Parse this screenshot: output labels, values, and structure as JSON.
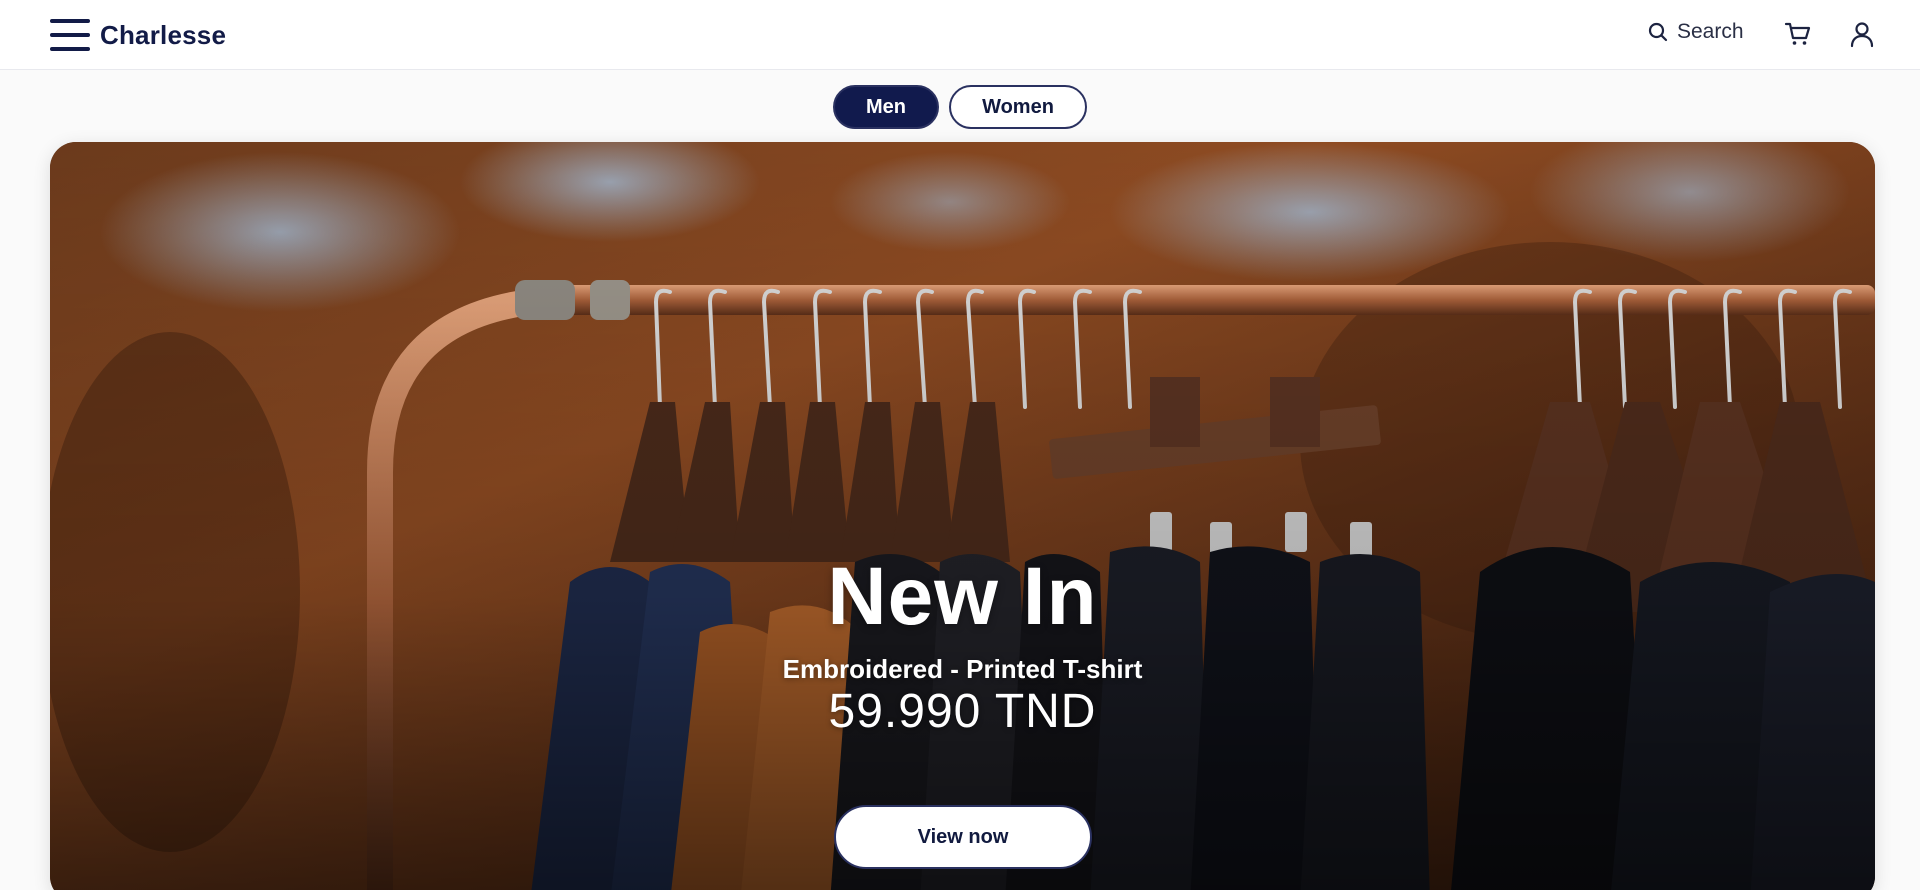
{
  "header": {
    "brand": "Charlesse",
    "menu_icon": "hamburger-menu-icon",
    "search_label": "Search",
    "search_icon": "search-icon",
    "cart_icon": "cart-icon",
    "user_icon": "user-icon"
  },
  "gender_toggle": {
    "options": [
      "Men",
      "Women"
    ],
    "selected": "Men"
  },
  "hero": {
    "title": "New In",
    "subtitle": "Embroidered - Printed T-shirt",
    "price": "59.990 TND",
    "cta_label": "View now"
  },
  "colors": {
    "primary": "#111a4d",
    "text": "#111a3f",
    "background": "#fafafa",
    "hero_rust": "#8a4a22"
  }
}
